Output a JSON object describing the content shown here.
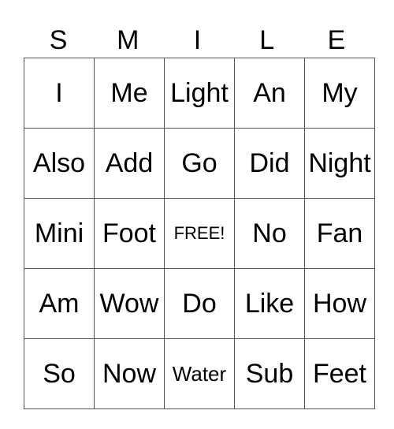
{
  "header": [
    "S",
    "M",
    "I",
    "L",
    "E"
  ],
  "rows": [
    [
      "I",
      "Me",
      "Light",
      "An",
      "My"
    ],
    [
      "Also",
      "Add",
      "Go",
      "Did",
      "Night"
    ],
    [
      "Mini",
      "Foot",
      "FREE!",
      "No",
      "Fan"
    ],
    [
      "Am",
      "Wow",
      "Do",
      "Like",
      "How"
    ],
    [
      "So",
      "Now",
      "Water",
      "Sub",
      "Feet"
    ]
  ]
}
